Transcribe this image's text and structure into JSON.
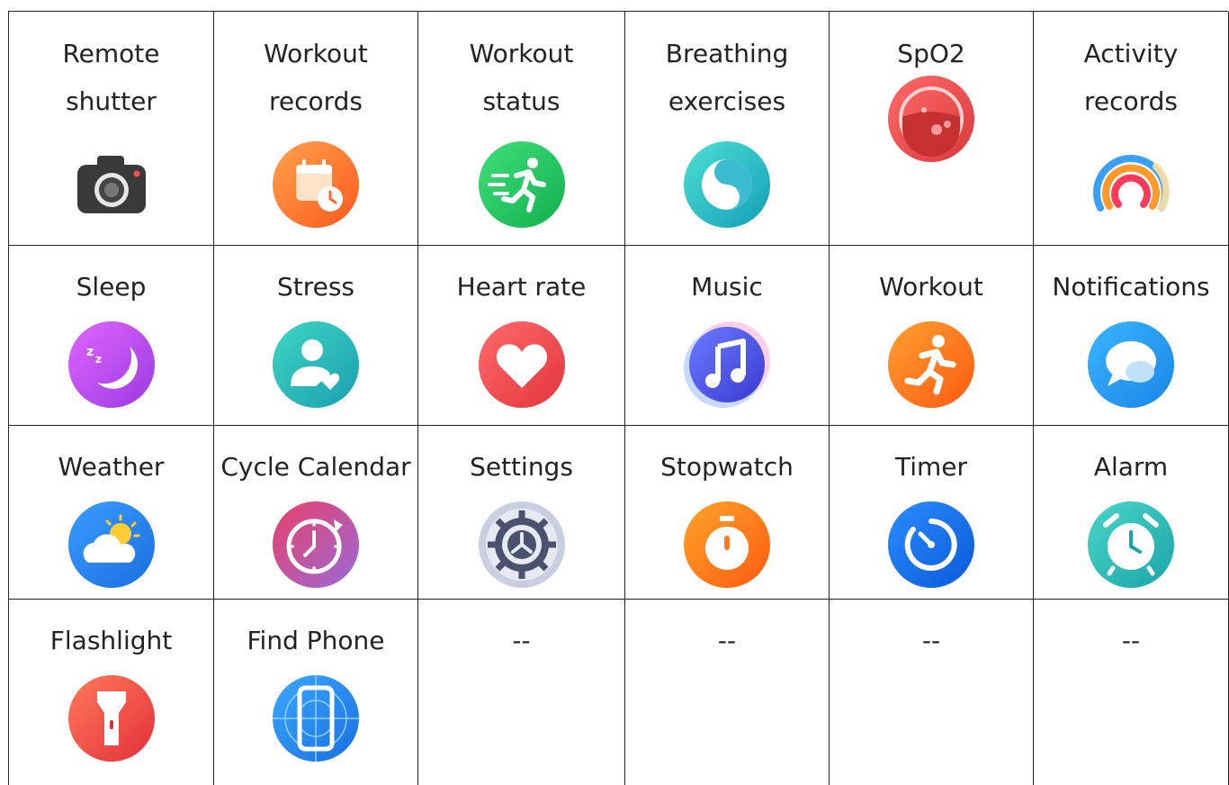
{
  "cells": [
    {
      "label": "Remote\nshutter",
      "icon": "camera-icon"
    },
    {
      "label": "Workout\nrecords",
      "icon": "calendar-clock-icon"
    },
    {
      "label": "Workout\nstatus",
      "icon": "running-person-icon"
    },
    {
      "label": "Breathing\nexercises",
      "icon": "breathing-icon"
    },
    {
      "label": "SpO2",
      "icon": "blood-oxygen-icon"
    },
    {
      "label": "Activity\nrecords",
      "icon": "activity-rings-icon"
    },
    {
      "label": "Sleep",
      "icon": "moon-icon"
    },
    {
      "label": "Stress",
      "icon": "person-heart-icon"
    },
    {
      "label": "Heart rate",
      "icon": "heart-icon"
    },
    {
      "label": "Music",
      "icon": "music-note-icon"
    },
    {
      "label": "Workout",
      "icon": "runner-icon"
    },
    {
      "label": "Notifications",
      "icon": "chat-bubble-icon"
    },
    {
      "label": "Weather",
      "icon": "sun-cloud-icon"
    },
    {
      "label": "Cycle Calendar",
      "icon": "cycle-clock-icon"
    },
    {
      "label": "Settings",
      "icon": "gear-icon"
    },
    {
      "label": "Stopwatch",
      "icon": "stopwatch-icon"
    },
    {
      "label": "Timer",
      "icon": "timer-icon"
    },
    {
      "label": "Alarm",
      "icon": "alarm-clock-icon"
    },
    {
      "label": "Flashlight",
      "icon": "flashlight-icon"
    },
    {
      "label": "Find Phone",
      "icon": "phone-search-icon"
    },
    {
      "label": "--",
      "icon": ""
    },
    {
      "label": "--",
      "icon": ""
    },
    {
      "label": "--",
      "icon": ""
    },
    {
      "label": "--",
      "icon": ""
    }
  ],
  "colors": {
    "border": "#222222",
    "text": "#222222"
  }
}
